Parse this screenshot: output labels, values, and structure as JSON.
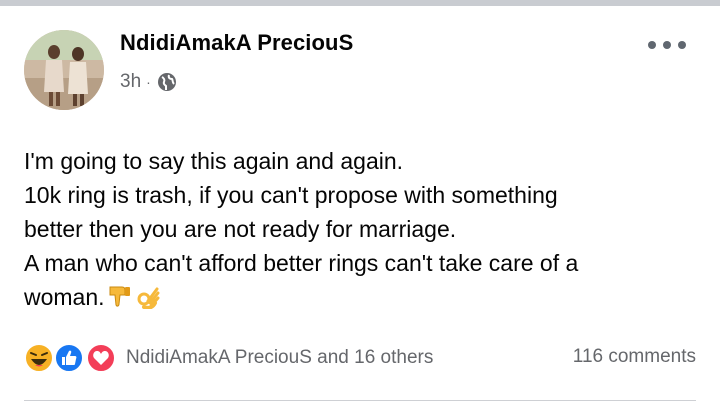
{
  "post": {
    "author": "NdidiAmakA PreciouS",
    "time": "3h",
    "separator": "·",
    "privacy_icon": "globe-icon",
    "more_icon": "more-options-icon",
    "lines": [
      "I'm going to say this again and again.",
      "10k ring is trash, if you can't propose with something",
      "better then you are not ready for marriage.",
      "A man who can't afford better rings can't take care of a",
      "woman."
    ],
    "emojis": [
      "thumbs-down-icon",
      "ok-hand-icon"
    ]
  },
  "reactions": {
    "icons": [
      "haha-reaction-icon",
      "like-reaction-icon",
      "love-reaction-icon"
    ],
    "summary": "NdidiAmakA PreciouS and 16 others",
    "comments": "116 comments"
  },
  "colors": {
    "text": "#050505",
    "secondary": "#65676b",
    "like": "#1877f2",
    "love": "#f33e58",
    "haha": "#f7b125"
  }
}
